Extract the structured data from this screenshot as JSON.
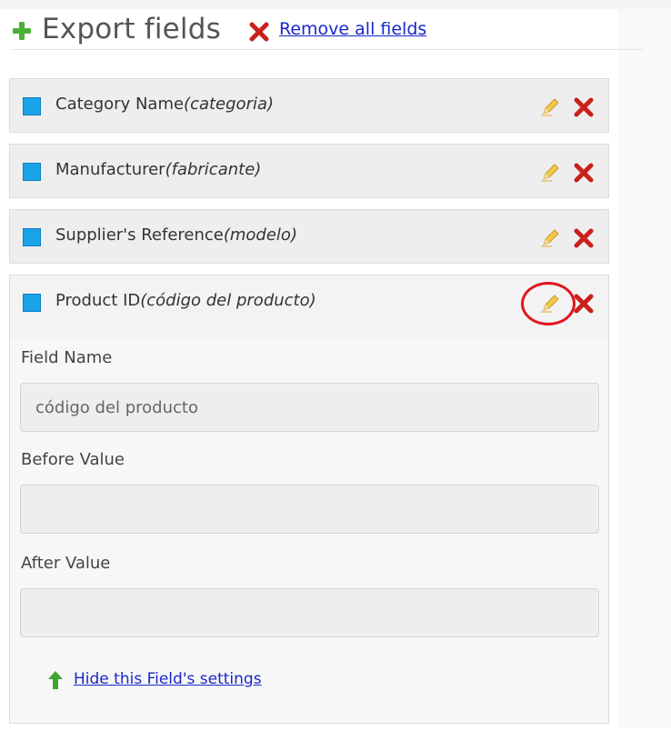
{
  "header": {
    "title": "Export fields",
    "remove_all_label": "Remove all fields",
    "icons": {
      "add": "plus-icon",
      "remove": "x-icon"
    }
  },
  "fields": [
    {
      "label": "Category Name",
      "column": "(categoria)",
      "state": "collapsed"
    },
    {
      "label": "Manufacturer",
      "column": "(fabricante)",
      "state": "collapsed"
    },
    {
      "label": "Supplier's Reference",
      "column": "(modelo)",
      "state": "collapsed"
    },
    {
      "label": "Product ID",
      "column": "(código del producto)",
      "state": "expanded"
    }
  ],
  "settings": {
    "field_name_label": "Field Name",
    "field_name_value": "código del producto",
    "before_value_label": "Before Value",
    "before_value_value": "",
    "after_value_label": "After Value",
    "after_value_value": "",
    "hide_link": "Hide this Field's settings"
  },
  "colors": {
    "accent_blue": "#1aa3e8",
    "delete_red": "#c8221a",
    "link": "#1a27c9",
    "highlight_circle": "#e3151d",
    "add_green": "#4caf3a"
  }
}
